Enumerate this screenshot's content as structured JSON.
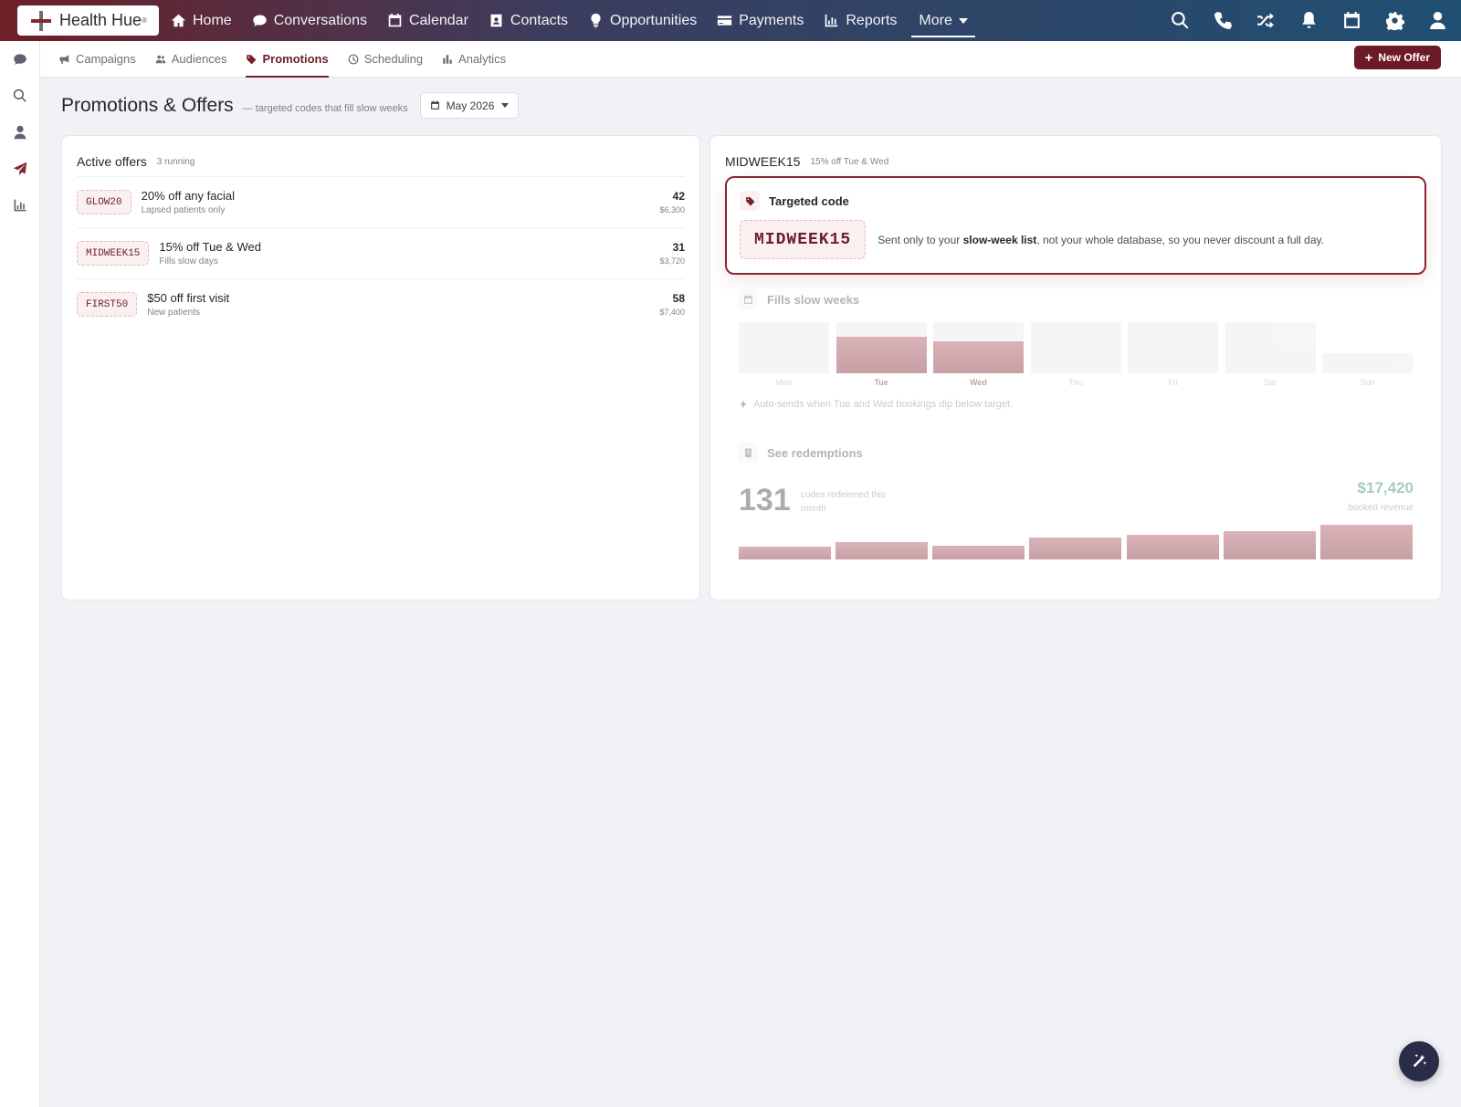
{
  "brand": {
    "name": "Health Hue",
    "tm": "®"
  },
  "nav": [
    {
      "label": "Home",
      "icon": "home-icon"
    },
    {
      "label": "Conversations",
      "icon": "chat-icon"
    },
    {
      "label": "Calendar",
      "icon": "calendar-icon"
    },
    {
      "label": "Contacts",
      "icon": "contact-card-icon"
    },
    {
      "label": "Opportunities",
      "icon": "lightbulb-icon"
    },
    {
      "label": "Payments",
      "icon": "credit-card-icon"
    },
    {
      "label": "Reports",
      "icon": "bar-chart-icon"
    },
    {
      "label": "More",
      "icon": "chevron-down-icon"
    }
  ],
  "top_icons": [
    "search-icon",
    "phone-icon",
    "shuffle-icon",
    "bell-icon",
    "calendar-icon",
    "gear-icon",
    "user-icon"
  ],
  "left_icons": [
    "chat-icon",
    "search-icon",
    "user-icon",
    "paper-plane-icon",
    "bar-chart-icon"
  ],
  "subnav": [
    {
      "label": "Campaigns",
      "icon": "megaphone-icon",
      "active": false
    },
    {
      "label": "Audiences",
      "icon": "users-icon",
      "active": false
    },
    {
      "label": "Promotions",
      "icon": "tag-icon",
      "active": true
    },
    {
      "label": "Scheduling",
      "icon": "clock-icon",
      "active": false
    },
    {
      "label": "Analytics",
      "icon": "bar-chart-icon",
      "active": false
    }
  ],
  "new_offer_label": "New Offer",
  "page": {
    "title": "Promotions & Offers",
    "subtitle": "— targeted codes that fill slow weeks",
    "month": "May 2026"
  },
  "active_offers": {
    "title": "Active offers",
    "count_label": "3 running",
    "items": [
      {
        "code": "GLOW20",
        "title": "20% off any facial",
        "desc": "Lapsed patients only",
        "count": "42",
        "revenue": "$6,300"
      },
      {
        "code": "MIDWEEK15",
        "title": "15% off Tue & Wed",
        "desc": "Fills slow days",
        "count": "31",
        "revenue": "$3,720"
      },
      {
        "code": "FIRST50",
        "title": "$50 off first visit",
        "desc": "New patients",
        "count": "58",
        "revenue": "$7,400"
      }
    ]
  },
  "detail": {
    "code": "MIDWEEK15",
    "code_desc": "15% off Tue & Wed",
    "targeted": {
      "title": "Targeted code",
      "text_before": "Sent only to your ",
      "text_bold": "slow-week list",
      "text_after": ", not your whole database, so you never discount a full day."
    },
    "slow_weeks": {
      "title": "Fills slow weeks",
      "days": [
        "Mon",
        "Tue",
        "Wed",
        "Thu",
        "Fri",
        "Sat",
        "Sun"
      ],
      "highlight": [
        false,
        true,
        true,
        false,
        false,
        false,
        false
      ],
      "fill": [
        0,
        0.72,
        0.63,
        0,
        0,
        0,
        0.4
      ],
      "note": "Auto-sends when Tue and Wed bookings dip below target."
    },
    "redemptions": {
      "title": "See redemptions",
      "count": "131",
      "count_label": "codes redeemed this month",
      "revenue": "$17,420",
      "revenue_label": "booked revenue",
      "bars": [
        0.37,
        0.5,
        0.4,
        0.63,
        0.71,
        0.82,
        1.0
      ]
    }
  },
  "colors": {
    "brand": "#7a1f2b",
    "revenue": "#2c8a5a"
  }
}
